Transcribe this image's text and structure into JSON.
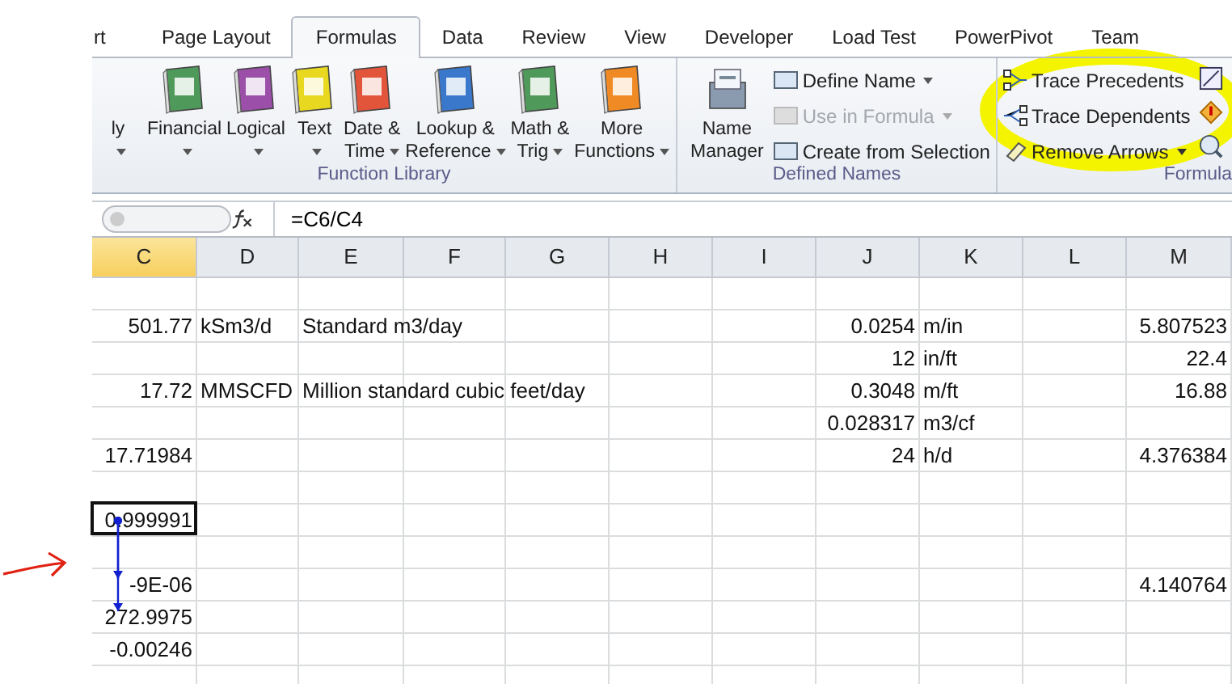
{
  "tabs": [
    {
      "label": "rt",
      "selected": false
    },
    {
      "label": "Page Layout",
      "selected": false
    },
    {
      "label": "Formulas",
      "selected": true
    },
    {
      "label": "Data",
      "selected": false
    },
    {
      "label": "Review",
      "selected": false
    },
    {
      "label": "View",
      "selected": false
    },
    {
      "label": "Developer",
      "selected": false
    },
    {
      "label": "Load Test",
      "selected": false
    },
    {
      "label": "PowerPivot",
      "selected": false
    },
    {
      "label": "Team",
      "selected": false
    }
  ],
  "function_library": {
    "label": "Function Library",
    "items": [
      {
        "lines": [
          "ly"
        ],
        "dropdown": true
      },
      {
        "lines": [
          "Financial"
        ],
        "color": "#4f9a5a",
        "dropdown": true
      },
      {
        "lines": [
          "Logical"
        ],
        "color": "#9b4fa8",
        "dropdown": true
      },
      {
        "lines": [
          "Text"
        ],
        "color": "#e8d820",
        "dropdown": true
      },
      {
        "lines": [
          "Date &",
          "Time"
        ],
        "color": "#e2553a",
        "dropdown": true
      },
      {
        "lines": [
          "Lookup &",
          "Reference"
        ],
        "color": "#3a78cc",
        "dropdown": true
      },
      {
        "lines": [
          "Math &",
          "Trig"
        ],
        "color": "#4f9a5a",
        "dropdown": true
      },
      {
        "lines": [
          "More",
          "Functions"
        ],
        "color": "#f08a24",
        "dropdown": true
      }
    ]
  },
  "defined_names": {
    "label": "Defined Names",
    "big": {
      "lines": [
        "Name",
        "Manager"
      ]
    },
    "items": [
      {
        "label": "Define Name",
        "dropdown": true,
        "disabled": false
      },
      {
        "label": "Use in Formula",
        "dropdown": true,
        "disabled": true
      },
      {
        "label": "Create from Selection",
        "dropdown": false,
        "disabled": false
      }
    ]
  },
  "formula_auditing": {
    "label": "Formula",
    "items": [
      {
        "label": "Trace Precedents",
        "kind": "precedents",
        "dropdown": false
      },
      {
        "label": "Trace Dependents",
        "kind": "dependents",
        "dropdown": false
      },
      {
        "label": "Remove Arrows",
        "kind": "remove",
        "dropdown": true
      }
    ]
  },
  "formula_bar": {
    "formula": "=C6/C4"
  },
  "columns": [
    {
      "label": "C",
      "selected": true
    },
    {
      "label": "D",
      "selected": false
    },
    {
      "label": "E",
      "selected": false
    },
    {
      "label": "F",
      "selected": false
    },
    {
      "label": "G",
      "selected": false
    },
    {
      "label": "H",
      "selected": false
    },
    {
      "label": "I",
      "selected": false
    },
    {
      "label": "J",
      "selected": false
    },
    {
      "label": "K",
      "selected": false
    },
    {
      "label": "L",
      "selected": false
    },
    {
      "label": "M",
      "selected": false
    }
  ],
  "rows": [
    {},
    {
      "cells": [
        {
          "text": "501.77",
          "kind": "number",
          "selected": false,
          "traced": false
        },
        {
          "text": "kSm3/d",
          "kind": "text",
          "selected": false,
          "traced": false
        },
        {
          "text": "Standard m3/day",
          "kind": "text",
          "selected": false,
          "traced": false
        },
        {},
        {},
        {},
        {},
        {
          "text": "0.0254",
          "kind": "number",
          "selected": false,
          "traced": false
        },
        {
          "text": "m/in",
          "kind": "text",
          "selected": false,
          "traced": false
        },
        {},
        {
          "text": "5.807523",
          "kind": "number",
          "selected": false,
          "traced": false
        }
      ]
    },
    {
      "cells": [
        {},
        {},
        {},
        {},
        {},
        {},
        {},
        {
          "text": "12",
          "kind": "number",
          "selected": false,
          "traced": false
        },
        {
          "text": "in/ft",
          "kind": "text",
          "selected": false,
          "traced": false
        },
        {},
        {
          "text": "22.4",
          "kind": "number",
          "selected": false,
          "traced": false
        }
      ]
    },
    {
      "cells": [
        {
          "text": "17.72",
          "kind": "number",
          "selected": false,
          "traced": false
        },
        {
          "text": "MMSCFD",
          "kind": "text",
          "selected": false,
          "traced": false
        },
        {
          "text": "Million standard cubic feet/day",
          "kind": "text",
          "selected": false,
          "traced": false
        },
        {},
        {},
        {},
        {},
        {
          "text": "0.3048",
          "kind": "number",
          "selected": false,
          "traced": false
        },
        {
          "text": "m/ft",
          "kind": "text",
          "selected": false,
          "traced": false
        },
        {},
        {
          "text": "16.88",
          "kind": "number",
          "selected": false,
          "traced": false
        }
      ]
    },
    {
      "cells": [
        {},
        {},
        {},
        {},
        {},
        {},
        {},
        {
          "text": "0.028317",
          "kind": "number",
          "selected": false,
          "traced": false
        },
        {
          "text": "m3/cf",
          "kind": "text",
          "selected": false,
          "traced": false
        }
      ]
    },
    {
      "cells": [
        {
          "text": "17.71984",
          "kind": "number",
          "selected": false,
          "traced": false
        },
        {},
        {},
        {},
        {},
        {},
        {},
        {
          "text": "24",
          "kind": "number",
          "selected": false,
          "traced": false
        },
        {
          "text": "h/d",
          "kind": "text",
          "selected": false,
          "traced": false
        },
        {},
        {
          "text": "4.376384",
          "kind": "number",
          "selected": false,
          "traced": false
        }
      ]
    },
    {},
    {
      "cells": [
        {
          "text": "0.999991",
          "kind": "number",
          "selected": true,
          "traced": false
        }
      ]
    },
    {},
    {
      "cells": [
        {
          "text": "-9E-06",
          "kind": "number",
          "selected": false,
          "traced": true
        },
        {},
        {},
        {},
        {},
        {},
        {},
        {},
        {},
        {},
        {
          "text": "4.140764",
          "kind": "number",
          "selected": false,
          "traced": false
        }
      ]
    },
    {
      "cells": [
        {
          "text": "272.9975",
          "kind": "number",
          "selected": false,
          "traced": true
        }
      ]
    },
    {
      "cells": [
        {
          "text": "-0.00246",
          "kind": "number",
          "selected": false,
          "traced": false
        }
      ]
    },
    {}
  ]
}
